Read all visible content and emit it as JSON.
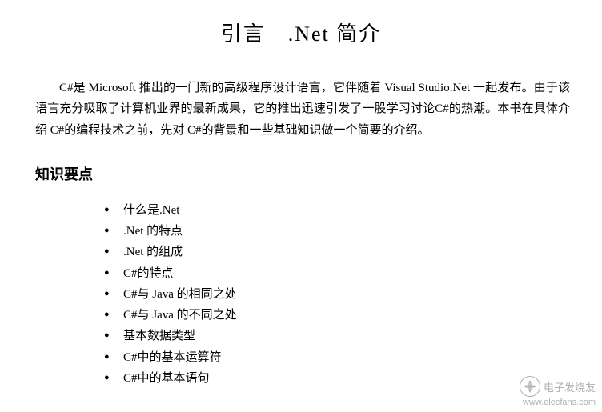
{
  "title": "引言　.Net 简介",
  "intro": "C#是 Microsoft 推出的一门新的高级程序设计语言，它伴随着 Visual Studio.Net 一起发布。由于该语言充分吸取了计算机业界的最新成果，它的推出迅速引发了一股学习讨论C#的热潮。本书在具体介绍 C#的编程技术之前，先对 C#的背景和一些基础知识做一个简要的介绍。",
  "section_heading": "知识要点",
  "bullets": [
    "什么是.Net",
    ".Net 的特点",
    ".Net 的组成",
    "C#的特点",
    "C#与 Java 的相同之处",
    "C#与 Java 的不同之处",
    "基本数据类型",
    "C#中的基本运算符",
    "C#中的基本语句"
  ],
  "watermark": {
    "brand": "电子发烧友",
    "url": "www.elecfans.com"
  }
}
